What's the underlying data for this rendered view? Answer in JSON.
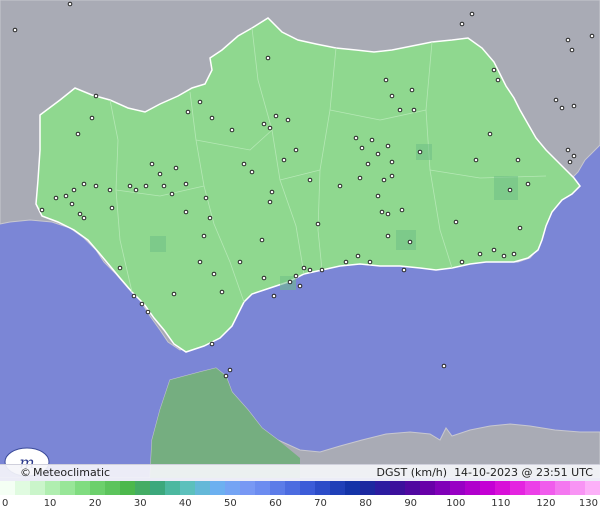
{
  "brand": {
    "symbol": "©",
    "name": "Meteoclimatic"
  },
  "caption": {
    "variable": "DGST (km/h)",
    "datetime": "14-10-2023 @ 23:51 UTC"
  },
  "scale": {
    "ticks": [
      "0",
      "10",
      "20",
      "30",
      "40",
      "50",
      "60",
      "70",
      "80",
      "90",
      "100",
      "110",
      "120",
      "130"
    ],
    "colors": [
      "#f4fff4",
      "#e0fbe0",
      "#caf5ca",
      "#b0eeb0",
      "#98e698",
      "#80dc80",
      "#6cd06c",
      "#5cc45c",
      "#4cb84c",
      "#44ac64",
      "#3ca87c",
      "#4cb8a0",
      "#5cc0bc",
      "#64b8d8",
      "#6cb0f0",
      "#74a4f4",
      "#7898f4",
      "#6c8cf0",
      "#5c7ce8",
      "#4c6ce0",
      "#3c5cd8",
      "#2c4cc8",
      "#2040b8",
      "#1434a8",
      "#1c28a0",
      "#2c1ca0",
      "#3c109c",
      "#5008a0",
      "#6800a8",
      "#8000b8",
      "#9800c4",
      "#b000cc",
      "#c400d4",
      "#d810d8",
      "#e424e0",
      "#ec40e8",
      "#f05cec",
      "#f478f0",
      "#f894f4",
      "#fcb0f8"
    ]
  },
  "map_colors": {
    "sea": "#7b86d6",
    "land_out": "#a7a9b3",
    "andalucia": "#8fd88f",
    "rif": "#6fae7a"
  }
}
